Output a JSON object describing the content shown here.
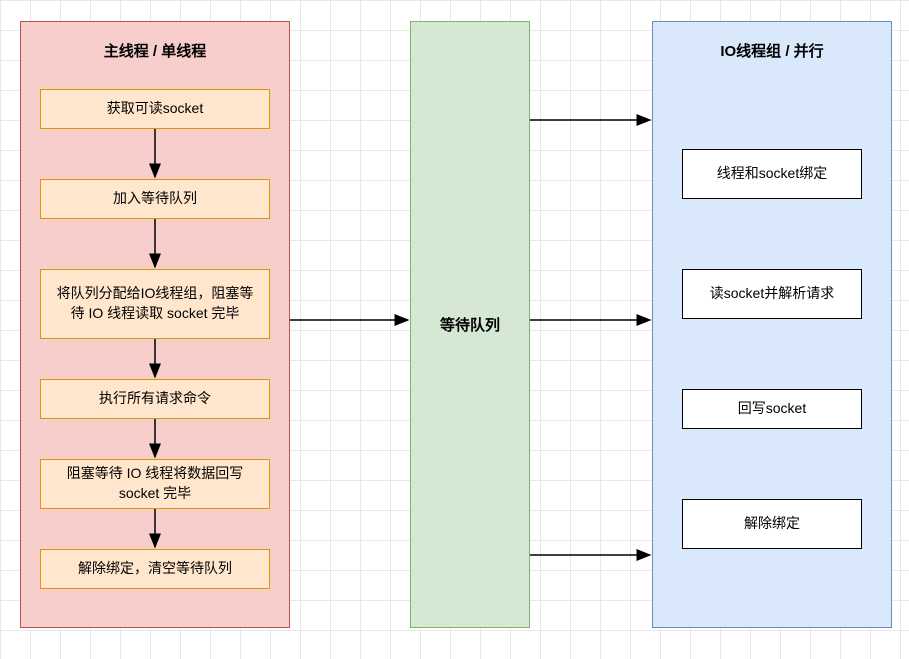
{
  "main_thread": {
    "title": "主线程 / 单线程",
    "steps": [
      "获取可读socket",
      "加入等待队列",
      "将队列分配给IO线程组，阻塞等待 IO 线程读取 socket 完毕",
      "执行所有请求命令",
      "阻塞等待 IO 线程将数据回写 socket 完毕",
      "解除绑定，清空等待队列"
    ]
  },
  "queue": {
    "label": "等待队列"
  },
  "io_thread": {
    "title": "IO线程组 / 并行",
    "steps": [
      "线程和socket绑定",
      "读socket并解析请求",
      "回写socket",
      "解除绑定"
    ]
  }
}
